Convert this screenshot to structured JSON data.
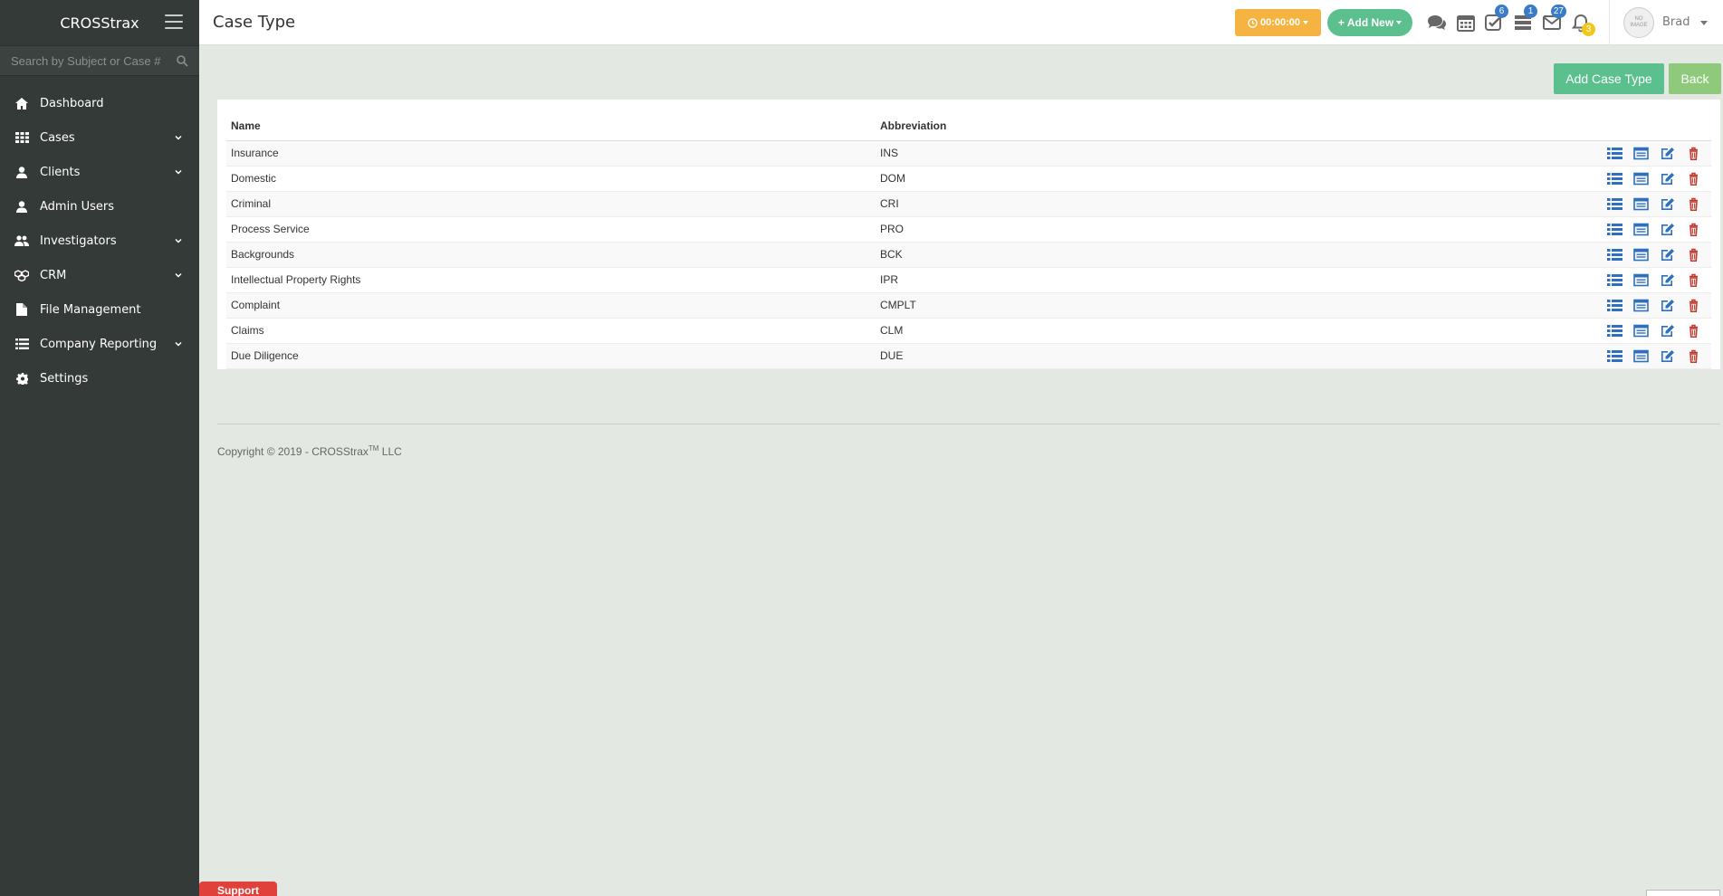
{
  "brand": "CROSStrax",
  "search": {
    "placeholder": "Search by Subject or Case #"
  },
  "nav": [
    {
      "label": "Dashboard",
      "icon": "home-icon",
      "expandable": false
    },
    {
      "label": "Cases",
      "icon": "grid-icon",
      "expandable": true
    },
    {
      "label": "Clients",
      "icon": "user-icon",
      "expandable": true
    },
    {
      "label": "Admin Users",
      "icon": "user-icon",
      "expandable": false
    },
    {
      "label": "Investigators",
      "icon": "users-icon",
      "expandable": true
    },
    {
      "label": "CRM",
      "icon": "cubes-icon",
      "expandable": true
    },
    {
      "label": "File Management",
      "icon": "file-icon",
      "expandable": false
    },
    {
      "label": "Company Reporting",
      "icon": "list-icon",
      "expandable": true
    },
    {
      "label": "Settings",
      "icon": "gear-icon",
      "expandable": false
    }
  ],
  "header": {
    "title": "Case Type",
    "timer": "00:00:00",
    "add_new": "Add New",
    "badges": {
      "tasks": "6",
      "list": "1",
      "mail": "27",
      "bell": "3"
    },
    "avatar_text": "NO IMAGE",
    "user": "Brad"
  },
  "actions": {
    "add": "Add Case Type",
    "back": "Back"
  },
  "table": {
    "columns": [
      "Name",
      "Abbreviation"
    ],
    "rows": [
      [
        "Insurance",
        "INS"
      ],
      [
        "Domestic",
        "DOM"
      ],
      [
        "Criminal",
        "CRI"
      ],
      [
        "Process Service",
        "PRO"
      ],
      [
        "Backgrounds",
        "BCK"
      ],
      [
        "Intellectual Property Rights",
        "IPR"
      ],
      [
        "Complaint",
        "CMPLT"
      ],
      [
        "Claims",
        "CLM"
      ],
      [
        "Due Diligence",
        "DUE"
      ]
    ]
  },
  "footer": {
    "copyright_prefix": "Copyright © 2019 - CROSStrax",
    "tm": "TM",
    "copyright_suffix": " LLC"
  },
  "support": "Support",
  "colors": {
    "sidebar": "#343a37",
    "accent_green": "#5bc08d",
    "timer": "#f5b441",
    "icon_blue": "#2f6fbf",
    "icon_red": "#c0392b"
  }
}
